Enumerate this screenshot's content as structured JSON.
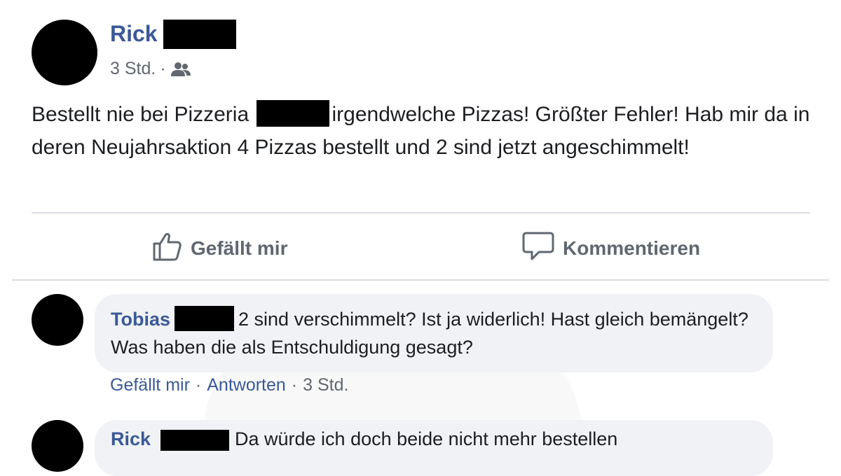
{
  "post": {
    "author": "Rick",
    "time": "3 Std.",
    "separator": "·",
    "audience_icon": "friends-icon",
    "text_before": "Bestellt nie bei Pizzeria ",
    "text_after": "irgendwelche Pizzas! Größter Fehler! Hab mir da in deren Neujahrsaktion 4 Pizzas bestellt und 2 sind jetzt angeschimmelt!"
  },
  "actions": {
    "like_label": "Gefällt mir",
    "like_icon": "thumbs-up-icon",
    "comment_label": "Kommentieren",
    "comment_icon": "speech-bubble-icon"
  },
  "comments": [
    {
      "author": "Tobias",
      "text": "2 sind verschimmelt? Ist ja widerlich! Hast gleich bemängelt? Was haben die als Entschuldigung gesagt?",
      "like_label": "Gefällt mir",
      "reply_label": "Antworten",
      "time": "3 Std.",
      "separator": "·"
    },
    {
      "author": "Rick",
      "text_partial": "Da würde ich doch beide nicht mehr bestellen"
    }
  ],
  "colors": {
    "link_blue": "#3b5998",
    "meta_gray": "#616770",
    "bubble_bg": "#f0f2f5",
    "divider": "#dadde1"
  }
}
